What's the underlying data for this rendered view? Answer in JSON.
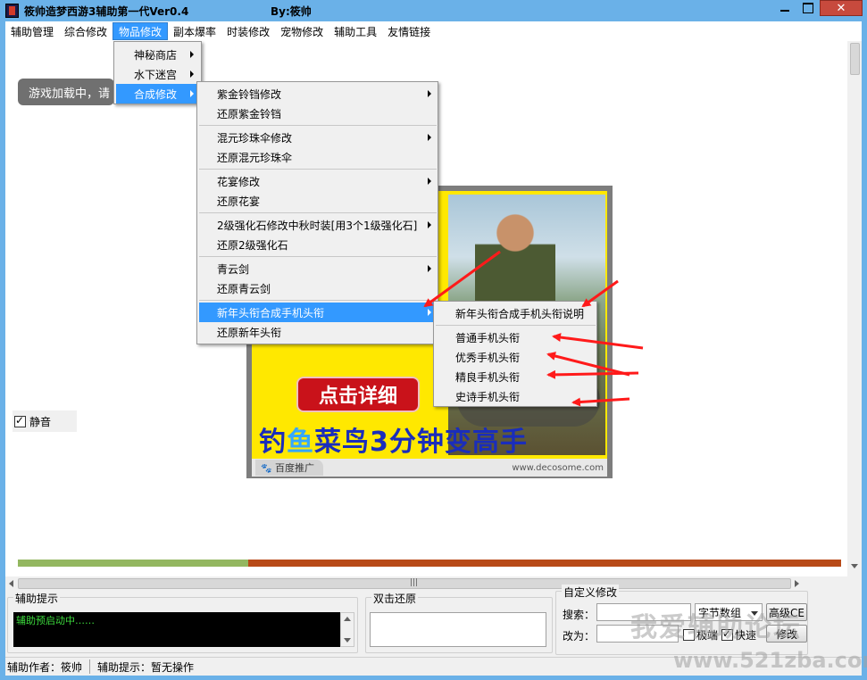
{
  "window": {
    "title": "筱帅造梦西游3辅助第一代Ver0.4",
    "author": "By:筱帅"
  },
  "menubar": {
    "items": [
      "辅助管理",
      "综合修改",
      "物品修改",
      "副本爆率",
      "时装修改",
      "宠物修改",
      "辅助工具",
      "友情链接"
    ],
    "active": "物品修改"
  },
  "loading_text": "游戏加载中，请",
  "mute": {
    "label": "静音",
    "checked": true
  },
  "ad": {
    "button": "点击详细",
    "slogan_part1": "钓",
    "slogan_highlight": "鱼",
    "slogan_part2": "菜鸟3分钟变高手",
    "baidu": "百度推广",
    "url": "www.decosome.com"
  },
  "menu_level1": [
    "神秘商店",
    "水下迷宫",
    "合成修改"
  ],
  "menu_level2": [
    "紫金铃铛修改",
    "还原紫金铃铛",
    "混元珍珠伞修改",
    "还原混元珍珠伞",
    "花宴修改",
    "还原花宴",
    "2级强化石修改中秋时装[用3个1级强化石]",
    "还原2级强化石",
    "青云剑",
    "还原青云剑",
    "新年头衔合成手机头衔",
    "还原新年头衔"
  ],
  "menu_level3": [
    "新年头衔合成手机头衔说明",
    "普通手机头衔",
    "优秀手机头衔",
    "精良手机头衔",
    "史诗手机头衔"
  ],
  "progress": {
    "fraction": 0.28
  },
  "hint_group": {
    "title": "辅助提示",
    "console": "辅助预启动中……"
  },
  "restore_group": {
    "title": "双击还原"
  },
  "custom_group": {
    "title": "自定义修改",
    "search_label": "搜索：",
    "replace_label": "改为：",
    "type_select": "字节数组",
    "advanced_button": "高级CE",
    "extreme_label": "极端",
    "extreme_checked": false,
    "fast_label": "快速",
    "fast_checked": true,
    "modify_button": "修改"
  },
  "statusbar": {
    "author": "辅助作者：筱帅",
    "hint": "辅助提示：暂无操作"
  },
  "watermark": {
    "line1": "我爱辅助论坛",
    "line2": "www.521zba.com"
  },
  "colors": {
    "accent": "#3399ff",
    "progress_fill": "#93b760",
    "progress_track": "#b84a18",
    "arrow": "#ff1a1a"
  }
}
